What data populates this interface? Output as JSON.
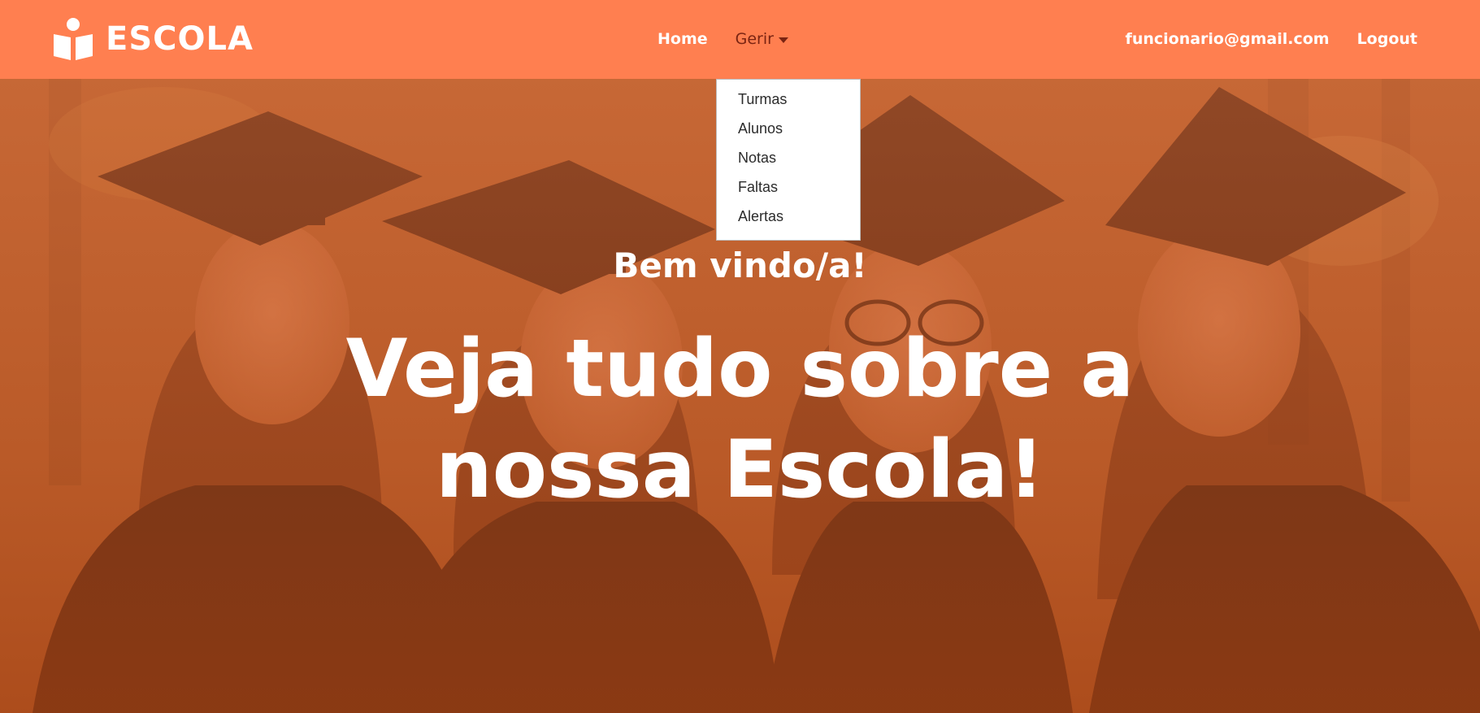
{
  "navbar": {
    "brand": "ESCOLA",
    "links": {
      "home": "Home",
      "gerir": "Gerir"
    },
    "user_email": "funcionario@gmail.com",
    "logout": "Logout",
    "background_color": "#ff7f50"
  },
  "dropdown": {
    "items": [
      "Turmas",
      "Alunos",
      "Notas",
      "Faltas",
      "Alertas"
    ]
  },
  "hero": {
    "subtitle": "Bem vindo/a!",
    "title": "Veja tudo sobre a nossa Escola!"
  },
  "icons": {
    "brand": "book-reader-icon",
    "dropdown_caret": "caret-down-icon"
  }
}
